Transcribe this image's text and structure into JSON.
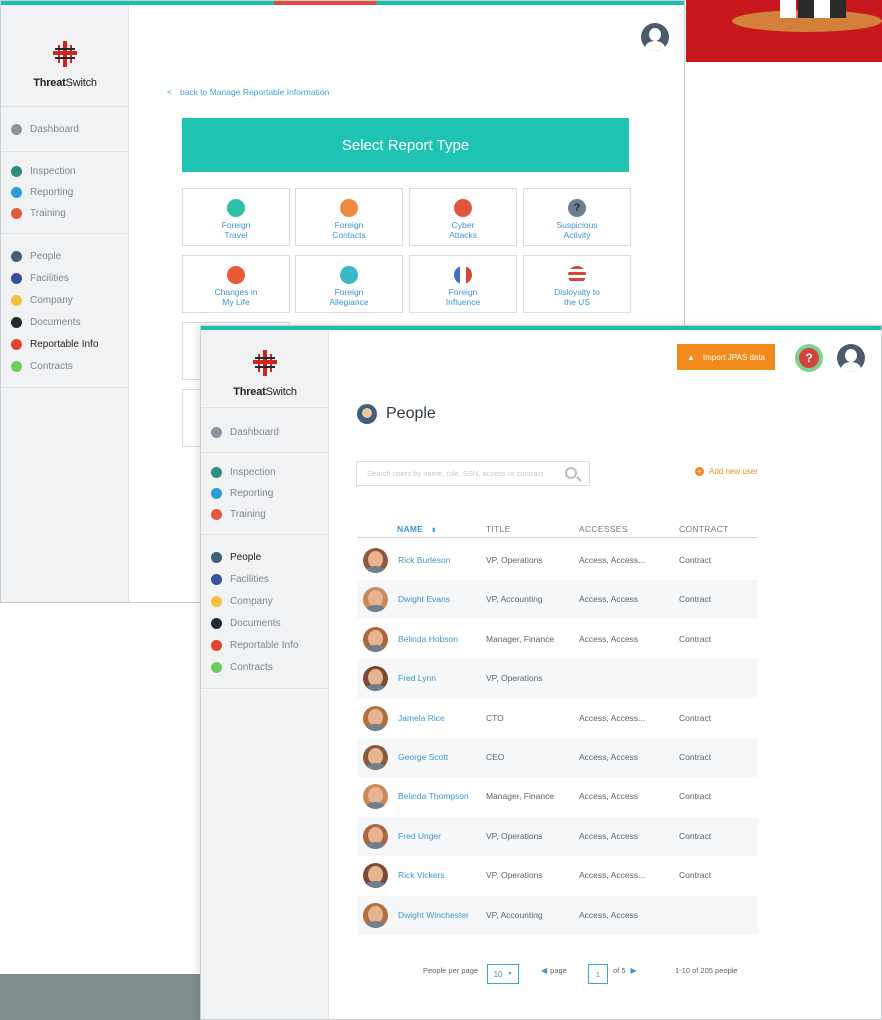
{
  "brand": {
    "logo_bold": "Threat",
    "logo_light": "Switch"
  },
  "sidebar": {
    "dashboard": "Dashboard",
    "group1": [
      "Inspection",
      "Reporting",
      "Training"
    ],
    "group2": [
      "People",
      "Facilities",
      "Company",
      "Documents",
      "Reportable Info",
      "Contracts"
    ]
  },
  "report_page": {
    "back_link": "back to Manage Reportable Information",
    "back_arrow": "<",
    "banner": "Select Report Type",
    "tiles": [
      [
        "Foreign",
        "Travel"
      ],
      [
        "Foreign",
        "Contacts"
      ],
      [
        "Cyber",
        "Attacks"
      ],
      [
        "Suspicious",
        "Activity"
      ],
      [
        "Changes in",
        "My Life"
      ],
      [
        "Foreign",
        "Allegiance"
      ],
      [
        "Foreign",
        "Influence"
      ],
      [
        "Disloyalty to",
        "the US"
      ]
    ]
  },
  "people_page": {
    "import_label": "Import JPAS data",
    "help_label": "?",
    "title": "People",
    "search_placeholder": "Search users by name, role, SSN, access or contract",
    "add_user": "Add new user",
    "columns": {
      "name": "NAME",
      "title": "TITLE",
      "accesses": "ACCESSES",
      "contract": "CONTRACT"
    },
    "sort_glyph": "⬍",
    "rows": [
      {
        "name": "Rick Burleson",
        "title": "VP, Operations",
        "accesses": "Access, Access...",
        "contract": "Contract"
      },
      {
        "name": "Dwight Evans",
        "title": "VP, Accounting",
        "accesses": "Access, Access",
        "contract": "Contract"
      },
      {
        "name": "Belinda Hobson",
        "title": "Manager, Finance",
        "accesses": "Access, Access",
        "contract": "Contract"
      },
      {
        "name": "Fred Lynn",
        "title": "VP, Operations",
        "accesses": "",
        "contract": ""
      },
      {
        "name": "Jamela Rice",
        "title": "CTO",
        "accesses": "Access, Access...",
        "contract": "Contract"
      },
      {
        "name": "George Scott",
        "title": "CEO",
        "accesses": "Access, Access",
        "contract": "Contract"
      },
      {
        "name": "Belinda Thompson",
        "title": "Manager, Finance",
        "accesses": "Access, Access",
        "contract": "Contract"
      },
      {
        "name": "Fred Unger",
        "title": "VP, Operations",
        "accesses": "Access, Access",
        "contract": "Contract"
      },
      {
        "name": "Rick Vickers",
        "title": "VP, Operations",
        "accesses": "Access, Access...",
        "contract": "Contract"
      },
      {
        "name": "Dwight Winchester",
        "title": "VP, Accounting",
        "accesses": "Access, Access",
        "contract": ""
      }
    ],
    "pagination": {
      "per_page_label": "People per page",
      "per_page_value": "10",
      "page_label": "page",
      "current_page": "1",
      "of_label": "of 5",
      "summary": "1-10 of 205 people"
    }
  },
  "colors": {
    "accent": "#1fc3b1",
    "link": "#3a96cf",
    "orange": "#f28b1c"
  }
}
